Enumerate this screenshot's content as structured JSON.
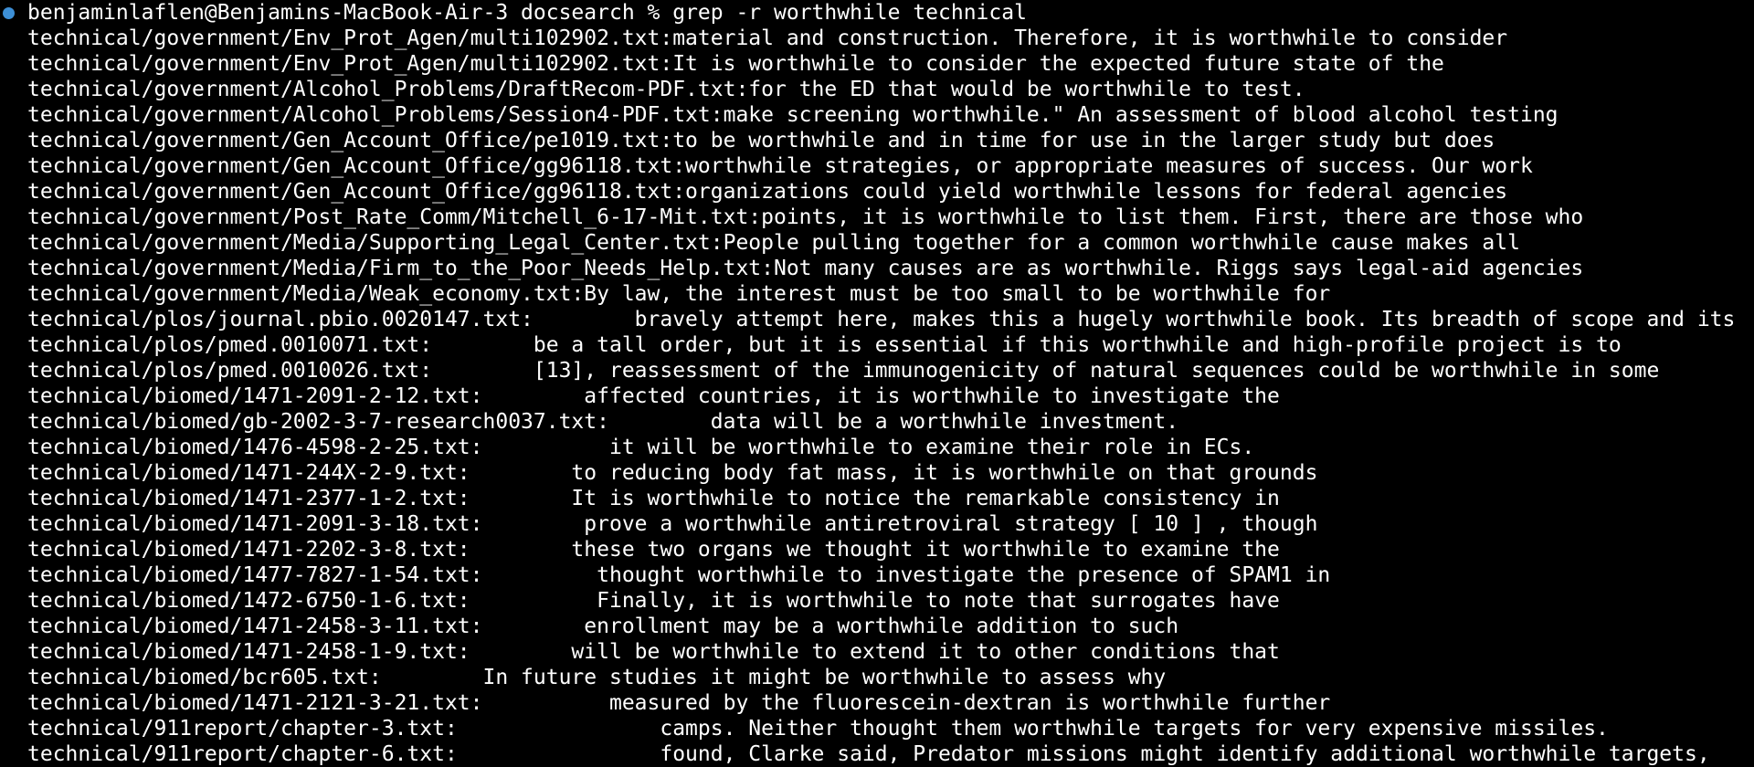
{
  "terminal": {
    "prompt": "benjaminlaflen@Benjamins-MacBook-Air-3 docsearch % ",
    "command": "grep -r worthwhile technical",
    "status_dot_color": "#3d8fd6",
    "output_lines": [
      "technical/government/Env_Prot_Agen/multi102902.txt:material and construction. Therefore, it is worthwhile to consider",
      "technical/government/Env_Prot_Agen/multi102902.txt:It is worthwhile to consider the expected future state of the",
      "technical/government/Alcohol_Problems/DraftRecom-PDF.txt:for the ED that would be worthwhile to test.",
      "technical/government/Alcohol_Problems/Session4-PDF.txt:make screening worthwhile.\" An assessment of blood alcohol testing",
      "technical/government/Gen_Account_Office/pe1019.txt:to be worthwhile and in time for use in the larger study but does",
      "technical/government/Gen_Account_Office/gg96118.txt:worthwhile strategies, or appropriate measures of success. Our work",
      "technical/government/Gen_Account_Office/gg96118.txt:organizations could yield worthwhile lessons for federal agencies",
      "technical/government/Post_Rate_Comm/Mitchell_6-17-Mit.txt:points, it is worthwhile to list them. First, there are those who",
      "technical/government/Media/Supporting_Legal_Center.txt:People pulling together for a common worthwhile cause makes all",
      "technical/government/Media/Firm_to_the_Poor_Needs_Help.txt:Not many causes are as worthwhile. Riggs says legal-aid agencies",
      "technical/government/Media/Weak_economy.txt:By law, the interest must be too small to be worthwhile for",
      "technical/plos/journal.pbio.0020147.txt:        bravely attempt here, makes this a hugely worthwhile book. Its breadth of scope and its",
      "technical/plos/pmed.0010071.txt:        be a tall order, but it is essential if this worthwhile and high-profile project is to",
      "technical/plos/pmed.0010026.txt:        [13], reassessment of the immunogenicity of natural sequences could be worthwhile in some",
      "technical/biomed/1471-2091-2-12.txt:        affected countries, it is worthwhile to investigate the",
      "technical/biomed/gb-2002-3-7-research0037.txt:        data will be a worthwhile investment.",
      "technical/biomed/1476-4598-2-25.txt:          it will be worthwhile to examine their role in ECs.",
      "technical/biomed/1471-244X-2-9.txt:        to reducing body fat mass, it is worthwhile on that grounds",
      "technical/biomed/1471-2377-1-2.txt:        It is worthwhile to notice the remarkable consistency in",
      "technical/biomed/1471-2091-3-18.txt:        prove a worthwhile antiretroviral strategy [ 10 ] , though",
      "technical/biomed/1471-2202-3-8.txt:        these two organs we thought it worthwhile to examine the",
      "technical/biomed/1477-7827-1-54.txt:         thought worthwhile to investigate the presence of SPAM1 in",
      "technical/biomed/1472-6750-1-6.txt:          Finally, it is worthwhile to note that surrogates have",
      "technical/biomed/1471-2458-3-11.txt:        enrollment may be a worthwhile addition to such",
      "technical/biomed/1471-2458-1-9.txt:        will be worthwhile to extend it to other conditions that",
      "technical/biomed/bcr605.txt:        In future studies it might be worthwhile to assess why",
      "technical/biomed/1471-2121-3-21.txt:          measured by the fluorescein-dextran is worthwhile further",
      "technical/911report/chapter-3.txt:                camps. Neither thought them worthwhile targets for very expensive missiles.",
      "technical/911report/chapter-6.txt:                found, Clarke said, Predator missions might identify additional worthwhile targets,"
    ]
  }
}
